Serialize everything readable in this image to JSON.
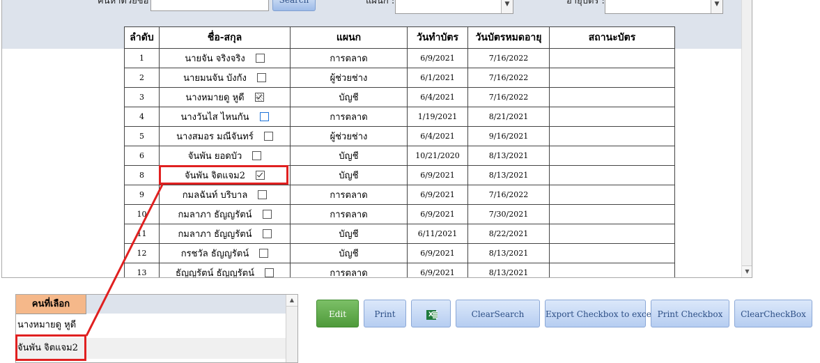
{
  "filters": {
    "name_label": "ค้นหาด้วยชื่อ :",
    "search_button": "Search",
    "dept_label": "แผนก :",
    "expire_label": "อายุบัตร :"
  },
  "table": {
    "headers": [
      "ลำดับ",
      "ชื่อ-สกุล",
      "แผนก",
      "วันทำบัตร",
      "วันบัตรหมดอายุ",
      "สถานะบัตร"
    ],
    "rows": [
      {
        "no": "1",
        "name": "นายจัน จริงจริง",
        "dept": "การตลาด",
        "issued": "6/9/2021",
        "expires": "7/16/2022",
        "status": "",
        "check": "unchecked"
      },
      {
        "no": "2",
        "name": "นายมนจัน บังกัง",
        "dept": "ผู้ช่วยช่าง",
        "issued": "6/1/2021",
        "expires": "7/16/2022",
        "status": "",
        "check": "unchecked"
      },
      {
        "no": "3",
        "name": "นางหมายดู หูดี",
        "dept": "บัญชี",
        "issued": "6/4/2021",
        "expires": "7/16/2022",
        "status": "",
        "check": "pressed"
      },
      {
        "no": "4",
        "name": "นางวันไส ไหนกัน",
        "dept": "การตลาด",
        "issued": "1/19/2021",
        "expires": "8/21/2021",
        "status": "",
        "check": "hover"
      },
      {
        "no": "5",
        "name": "นางสมอร มณีจันทร์",
        "dept": "ผู้ช่วยช่าง",
        "issued": "6/4/2021",
        "expires": "9/16/2021",
        "status": "",
        "check": "unchecked"
      },
      {
        "no": "6",
        "name": "จันพัน ยอดบัว",
        "dept": "บัญชี",
        "issued": "10/21/2020",
        "expires": "8/13/2021",
        "status": "",
        "check": "unchecked"
      },
      {
        "no": "8",
        "name": "จันพัน จิตแจม2",
        "dept": "บัญชี",
        "issued": "6/9/2021",
        "expires": "8/13/2021",
        "status": "",
        "check": "checked"
      },
      {
        "no": "9",
        "name": "กมลฉันท์ บริบาล",
        "dept": "การตลาด",
        "issued": "6/9/2021",
        "expires": "7/16/2022",
        "status": "",
        "check": "unchecked"
      },
      {
        "no": "10",
        "name": "กมลาภา ธัญญรัตน์",
        "dept": "การตลาด",
        "issued": "6/9/2021",
        "expires": "7/30/2021",
        "status": "",
        "check": "unchecked"
      },
      {
        "no": "11",
        "name": "กมลาภา ธัญญรัตน์",
        "dept": "บัญชี",
        "issued": "6/11/2021",
        "expires": "8/22/2021",
        "status": "",
        "check": "unchecked"
      },
      {
        "no": "12",
        "name": "กรชวัล ธัญญรัตน์",
        "dept": "บัญชี",
        "issued": "6/9/2021",
        "expires": "8/13/2021",
        "status": "",
        "check": "unchecked"
      },
      {
        "no": "13",
        "name": "ธัญญรัตน์ ธัญญรัตน์",
        "dept": "การตลาด",
        "issued": "6/9/2021",
        "expires": "8/13/2021",
        "status": "",
        "check": "unchecked"
      }
    ]
  },
  "selected_panel": {
    "header": "คนที่เลือก",
    "items": [
      "นางหมายดู หูดี",
      "จันพัน จิตแจม2"
    ]
  },
  "actions": {
    "edit": "Edit",
    "print": "Print",
    "export_excel_icon": "excel-icon",
    "clear_search": "ClearSearch",
    "export_checkbox": "Export Checkbox to excel",
    "print_checkbox": "Print Checkbox",
    "clear_checkbox": "ClearCheckBox"
  },
  "colors": {
    "highlight": "#e02020",
    "edit_button": "#5aa845",
    "selected_header": "#f5b88a"
  }
}
